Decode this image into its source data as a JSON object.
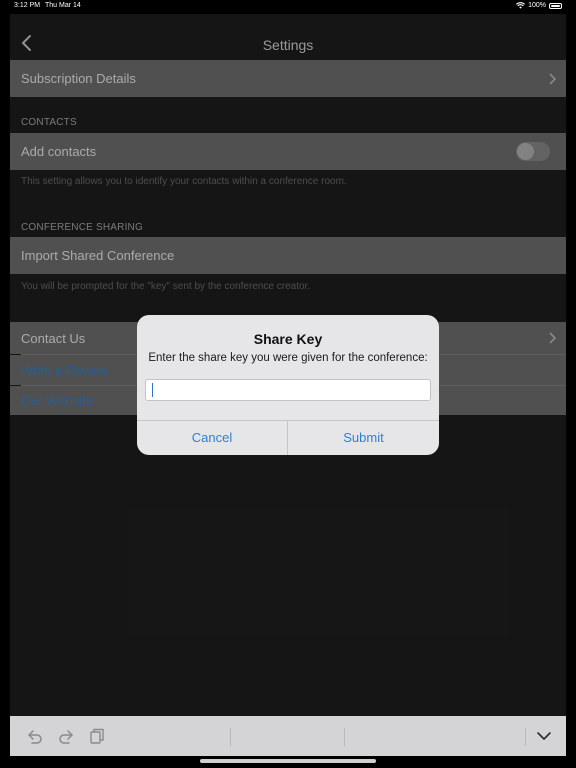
{
  "status_bar": {
    "time": "3:12 PM",
    "date": "Thu Mar 14",
    "battery": "100%"
  },
  "nav": {
    "title": "Settings"
  },
  "subscription": {
    "label": "Subscription Details"
  },
  "contacts": {
    "header": "CONTACTS",
    "add_label": "Add contacts",
    "add_enabled": false,
    "footnote": "This setting allows you to identify your contacts within a conference room."
  },
  "conference_sharing": {
    "header": "CONFERENCE SHARING",
    "import_label": "Import Shared Conference",
    "footnote": "You will be prompted for the \"key\" sent by the conference creator."
  },
  "links": {
    "contact_us": "Contact Us",
    "write_review": "Write a Review",
    "our_website": "Our Website"
  },
  "alert": {
    "title": "Share Key",
    "message": "Enter the share key you were given for the conference:",
    "input_value": "",
    "cancel": "Cancel",
    "submit": "Submit"
  },
  "toolbar": {
    "icons": [
      "undo-icon",
      "redo-icon",
      "paste-icon",
      "chevron-down-icon"
    ]
  },
  "colors": {
    "link": "#3b81c7",
    "alert_button": "#2f7fd6",
    "row_bg": "#6f6f6f"
  }
}
